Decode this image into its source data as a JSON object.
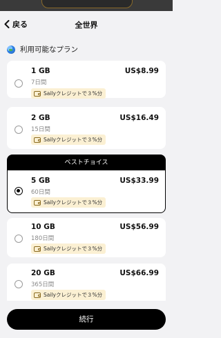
{
  "nav": {
    "back_label": "戻る",
    "title": "全世界"
  },
  "section": {
    "title": "利用可能なプラン"
  },
  "plans": [
    {
      "data": "1 GB",
      "days": "7日間",
      "price": "US$8.99",
      "credit": "Sailyクレジットで３%分",
      "selected": false
    },
    {
      "data": "2 GB",
      "days": "15日間",
      "price": "US$16.49",
      "credit": "Sailyクレジットで３%分",
      "selected": false
    },
    {
      "data": "5 GB",
      "days": "60日間",
      "price": "US$33.99",
      "credit": "Sailyクレジットで３%分",
      "selected": true,
      "badge": "ベストチョイス"
    },
    {
      "data": "10 GB",
      "days": "180日間",
      "price": "US$56.99",
      "credit": "Sailyクレジットで３%分",
      "selected": false
    },
    {
      "data": "20 GB",
      "days": "365日間",
      "price": "US$66.99",
      "credit": "Sailyクレジットで３%分",
      "selected": false
    }
  ],
  "footer": {
    "continue_label": "続行"
  },
  "colors": {
    "accent": "#000000",
    "credit_bg": "#fbf0d3",
    "background": "#f2f2f4"
  }
}
